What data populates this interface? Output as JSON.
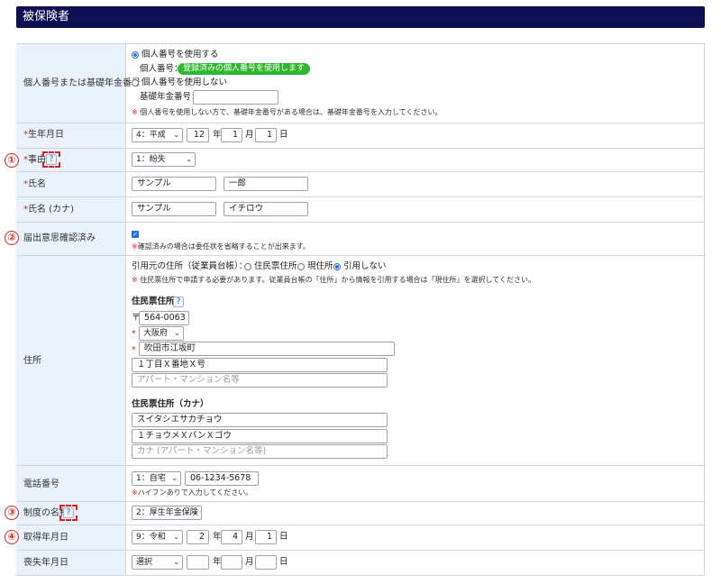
{
  "section_title": "被保険者",
  "labels": {
    "mynumber": "個人番号または基礎年金番号",
    "birth": "生年月日",
    "reason": "事由",
    "name": "氏名",
    "name_kana": "氏名 (カナ)",
    "intent": "届出意思確認済み",
    "address": "住所",
    "phone": "電話番号",
    "system": "制度の名称",
    "acquired": "取得年月日",
    "lost": "喪失年月日"
  },
  "required_mark": "*",
  "mynumber": {
    "use_label": "個人番号を使用する",
    "number_label": "個人番号：",
    "badge": "登録済みの個人番号を使用します",
    "notuse_label": "個人番号を使用しない",
    "pension_label": "基礎年金番号：",
    "pension_value": "",
    "note": "個人番号を使用しない方で、基礎年金番号がある場合は、基礎年金番号を入力してください。"
  },
  "note_mark": "※",
  "birth": {
    "era": "4：平成",
    "year": "12",
    "month": "1",
    "day": "1",
    "u_year": "年",
    "u_month": "月",
    "u_day": "日"
  },
  "help_glyph": "?",
  "reason": {
    "value": "1：紛失"
  },
  "name": {
    "last": "サンプル",
    "first": "一郎"
  },
  "name_kana": {
    "last": "サンプル",
    "first": "イチロウ"
  },
  "intent": {
    "checked": true,
    "note": "確認済みの場合は委任状を省略することが出来ます。"
  },
  "address": {
    "source_label": "引用元の住所（従業員台帳）：",
    "options": [
      "住民票住所",
      "現住所",
      "引用しない"
    ],
    "note": "住民票住所で申請する必要があります。従業員台帳の「住所」から情報を引用する場合は「現住所」を選択してください。",
    "heading": "住民票住所",
    "postal_mark": "〒",
    "postal": "564-0063",
    "prefecture": "大阪府",
    "city": "吹田市江坂町",
    "street": "１丁目Ｘ番地Ｘ号",
    "building_placeholder": "アパート・マンション名等",
    "kana_heading": "住民票住所（カナ）",
    "kana_city": "スイタシエサカチョウ",
    "kana_street": "１チョウメＸバンＸゴウ",
    "kana_building_placeholder": "カナ (アパート・マンション名等)"
  },
  "phone": {
    "type": "1：自宅",
    "number": "06-1234-5678",
    "note": "ハイフンありで入力してください。"
  },
  "system": {
    "value": "2：厚生年金保険"
  },
  "acquired": {
    "era": "9：令和",
    "year": "2",
    "month": "4",
    "day": "1"
  },
  "lost": {
    "era": "選択",
    "year": "",
    "month": "",
    "day": ""
  },
  "markers": [
    "①",
    "②",
    "③",
    "④"
  ],
  "dropdown_arrow": "⌄"
}
